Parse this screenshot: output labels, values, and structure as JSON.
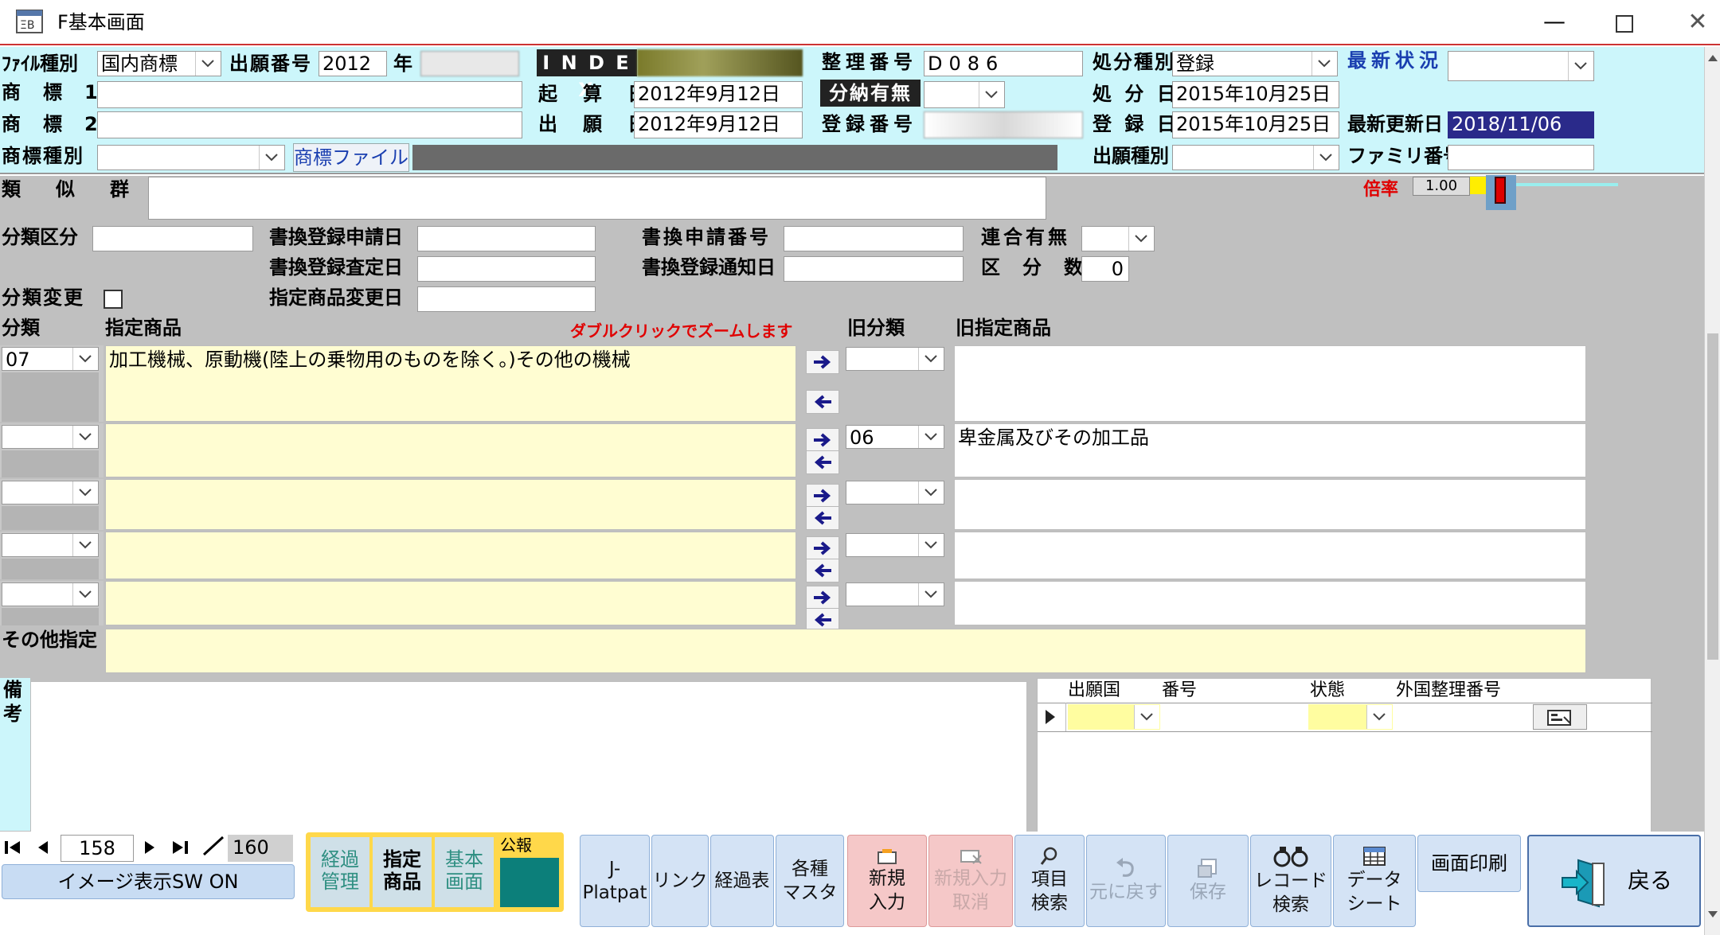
{
  "window": {
    "title": "F基本画面",
    "icon": "access-form-icon"
  },
  "header": {
    "file_type_label": "ﾌｧｲﾙ種別",
    "file_type_value": "国内商標",
    "app_no_label": "出願番号",
    "app_no_value": "2012",
    "year_label": "年",
    "index_label": "I N D E X",
    "trademark1_label": "商　標　1",
    "trademark2_label": "商　標　2",
    "trademark_type_label": "商標種別",
    "trademark_file_btn": "商標ファイル",
    "reckon_date_label": "起　算　日",
    "reckon_date_value": "2012年9月12日",
    "filing_date_label": "出　願　日",
    "filing_date_value": "2012年9月12日",
    "ref_no_label": "整理番号",
    "ref_no_value": "D086",
    "installment_label": "分納有無",
    "reg_no_label": "登録番号",
    "disposal_type_label": "処分種別",
    "disposal_type_value": "登録",
    "disposal_date_label": "処 分 日",
    "disposal_date_value": "2015年10月25日",
    "reg_date_label": "登 録 日",
    "reg_date_value": "2015年10月25日",
    "filing_type_label": "出願種別",
    "latest_status_label": "最新状況",
    "last_update_label": "最新更新日",
    "last_update_value": "2018/11/06",
    "family_no_label": "ファミリ番号"
  },
  "middle": {
    "similar_group_label": "類　似　群",
    "magnification_label": "倍率",
    "magnification_value": "1.00",
    "class_div_label": "分類区分",
    "rewrite_req_label": "書換登録申請日",
    "rewrite_exam_label": "書換登録査定日",
    "designated_change_label": "指定商品変更日",
    "rewrite_app_no_label": "書換申請番号",
    "rewrite_notice_label": "書換登録通知日",
    "assoc_label": "連合有無",
    "class_count_label": "区　分　数",
    "class_count_value": "0",
    "class_change_label": "分類変更",
    "class_col": "分類",
    "goods_col": "指定商品",
    "zoom_hint": "ダブルクリックでズームします",
    "old_class_col": "旧分類",
    "old_goods_col": "旧指定商品",
    "other_label": "その他指定",
    "notes_label": "備\n考"
  },
  "goods_rows": [
    {
      "class": "07",
      "goods": "加工機械、原動機(陸上の乗物用のものを除く。)その他の機械",
      "old_class": "",
      "old_goods": ""
    },
    {
      "class": "",
      "goods": "",
      "old_class": "06",
      "old_goods": "卑金属及びその加工品"
    },
    {
      "class": "",
      "goods": "",
      "old_class": "",
      "old_goods": ""
    },
    {
      "class": "",
      "goods": "",
      "old_class": "",
      "old_goods": ""
    },
    {
      "class": "",
      "goods": "",
      "old_class": "",
      "old_goods": ""
    }
  ],
  "foreign": {
    "col_country": "出願国",
    "col_no": "番号",
    "col_status": "状態",
    "col_foreign_ref": "外国整理番号"
  },
  "nav": {
    "current": "158",
    "total": "160",
    "image_btn": "イメージ表示SW ON",
    "koho": "公報"
  },
  "tabs": [
    {
      "label": "経過\n管理"
    },
    {
      "label": "指定\n商品"
    },
    {
      "label": "基本\n画面"
    }
  ],
  "toolbar": {
    "jplat": "J-\nPlatpat",
    "link": "リンク",
    "history": "経過表",
    "master": "各種\nマスタ",
    "new": "新規\n入力",
    "cancel_new": "新規入力\n取消",
    "search": "項目\n検索",
    "undo": "元に戻す",
    "save": "保存",
    "rec_search": "レコード\n検索",
    "datasheet": "データ\nシート",
    "print": "画面印刷",
    "back": "戻る"
  },
  "colors": {
    "header_bg": "#ccf6fb",
    "body_bg": "#c0c0c0",
    "yellow": "#fffdd2",
    "accent": "#2a2a8a"
  }
}
